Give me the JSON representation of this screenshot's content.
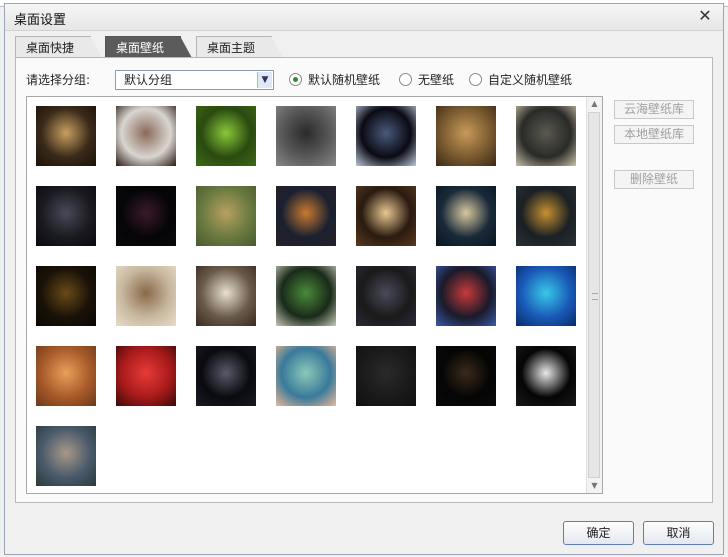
{
  "dialog": {
    "title": "桌面设置"
  },
  "tabs": [
    {
      "label": "桌面快捷",
      "active": false
    },
    {
      "label": "桌面壁纸",
      "active": true
    },
    {
      "label": "桌面主题",
      "active": false
    }
  ],
  "filter": {
    "group_label": "请选择分组:",
    "group_value": "默认分组",
    "options": [
      {
        "label": "默认随机壁纸",
        "checked": true
      },
      {
        "label": "无壁纸",
        "checked": false
      },
      {
        "label": "自定义随机壁纸",
        "checked": false
      }
    ]
  },
  "side_buttons": [
    {
      "label": "云海壁纸库",
      "enabled": false
    },
    {
      "label": "本地壁纸库",
      "enabled": false
    },
    {
      "label": "删除壁纸",
      "enabled": false
    }
  ],
  "footer": {
    "ok_label": "确定",
    "cancel_label": "取消"
  },
  "wallpapers": [
    {
      "name": "ghost-ship-wallpaper",
      "colors": [
        "#3a2a1a",
        "#c8a060",
        "#1a1208"
      ]
    },
    {
      "name": "two-women-wallpaper",
      "colors": [
        "#d9d5d0",
        "#8a6a5a",
        "#2a1a14"
      ]
    },
    {
      "name": "green-grass-wallpaper",
      "colors": [
        "#2a4a10",
        "#8ac83a",
        "#3c6a14"
      ]
    },
    {
      "name": "dark-figure-wallpaper",
      "colors": [
        "#5a5a5a",
        "#2a2a2a",
        "#888888"
      ]
    },
    {
      "name": "space-planet-wallpaper",
      "colors": [
        "#0a0a14",
        "#4a5a7a",
        "#bcc8d8"
      ]
    },
    {
      "name": "autumn-tree-wallpaper",
      "colors": [
        "#7a5a30",
        "#c89a5a",
        "#3a2a14"
      ]
    },
    {
      "name": "mushroom-wallpaper",
      "colors": [
        "#2a2a28",
        "#5a5a50",
        "#c8c0a8"
      ]
    },
    {
      "name": "fantasy-creatures-wallpaper",
      "colors": [
        "#1a1a20",
        "#4a4a5a",
        "#0a0a10"
      ]
    },
    {
      "name": "dark-portrait-wallpaper",
      "colors": [
        "#050508",
        "#3a1a2a",
        "#0a0a0a"
      ]
    },
    {
      "name": "field-sky-wallpaper",
      "colors": [
        "#6a7a40",
        "#b8a060",
        "#4a5a30"
      ]
    },
    {
      "name": "sunset-landscape-wallpaper",
      "colors": [
        "#1a2030",
        "#c87a30",
        "#2a2028"
      ]
    },
    {
      "name": "glowing-bird-wallpaper",
      "colors": [
        "#2a1a10",
        "#e8c890",
        "#5a3a20"
      ]
    },
    {
      "name": "moon-ship-wallpaper",
      "colors": [
        "#1a2a3a",
        "#d8c8a0",
        "#0a1420"
      ]
    },
    {
      "name": "gold-light-wallpaper",
      "colors": [
        "#1a2024",
        "#c89030",
        "#2a3034"
      ]
    },
    {
      "name": "golden-glow-wallpaper",
      "colors": [
        "#1a1208",
        "#6a4a18",
        "#0a0804"
      ]
    },
    {
      "name": "lioness-wallpaper",
      "colors": [
        "#c8b8a0",
        "#8a6a4a",
        "#e8dcc8"
      ]
    },
    {
      "name": "white-flower-wallpaper",
      "colors": [
        "#6a5a4a",
        "#e8e0d0",
        "#3a2a20"
      ]
    },
    {
      "name": "footballer-wallpaper",
      "colors": [
        "#1a2a1a",
        "#4a8a3a",
        "#c8c8b8"
      ]
    },
    {
      "name": "players-dark-wallpaper",
      "colors": [
        "#1a1a1a",
        "#4a4a5a",
        "#2a2a3a"
      ]
    },
    {
      "name": "team-photo-wallpaper",
      "colors": [
        "#1a1a2a",
        "#c83a3a",
        "#3a5aa8"
      ]
    },
    {
      "name": "blue-girl-wallpaper",
      "colors": [
        "#1a5ab8",
        "#3ac8e8",
        "#0a2a6a"
      ]
    },
    {
      "name": "orange-girl-wallpaper",
      "colors": [
        "#a85a2a",
        "#e8a05a",
        "#6a3a1a"
      ]
    },
    {
      "name": "red-poster-wallpaper",
      "colors": [
        "#a81a1a",
        "#e83a3a",
        "#3a0a0a"
      ]
    },
    {
      "name": "robot-wallpaper",
      "colors": [
        "#0a0a10",
        "#5a5a6a",
        "#1a1a24"
      ]
    },
    {
      "name": "blue-green-blur-wallpaper",
      "colors": [
        "#3a7a9a",
        "#8ac8b8",
        "#e8b898"
      ]
    },
    {
      "name": "dark-logo-wallpaper",
      "colors": [
        "#1a1a1a",
        "#2a2a2a",
        "#111111"
      ]
    },
    {
      "name": "bottles-wallpaper",
      "colors": [
        "#050505",
        "#3a2a1a",
        "#0a0a0a"
      ]
    },
    {
      "name": "dandelion-wallpaper",
      "colors": [
        "#050505",
        "#e8e8e8",
        "#1a1a1a"
      ]
    },
    {
      "name": "dream-figure-wallpaper",
      "colors": [
        "#4a5a6a",
        "#a8988a",
        "#2a3a3a"
      ]
    }
  ]
}
